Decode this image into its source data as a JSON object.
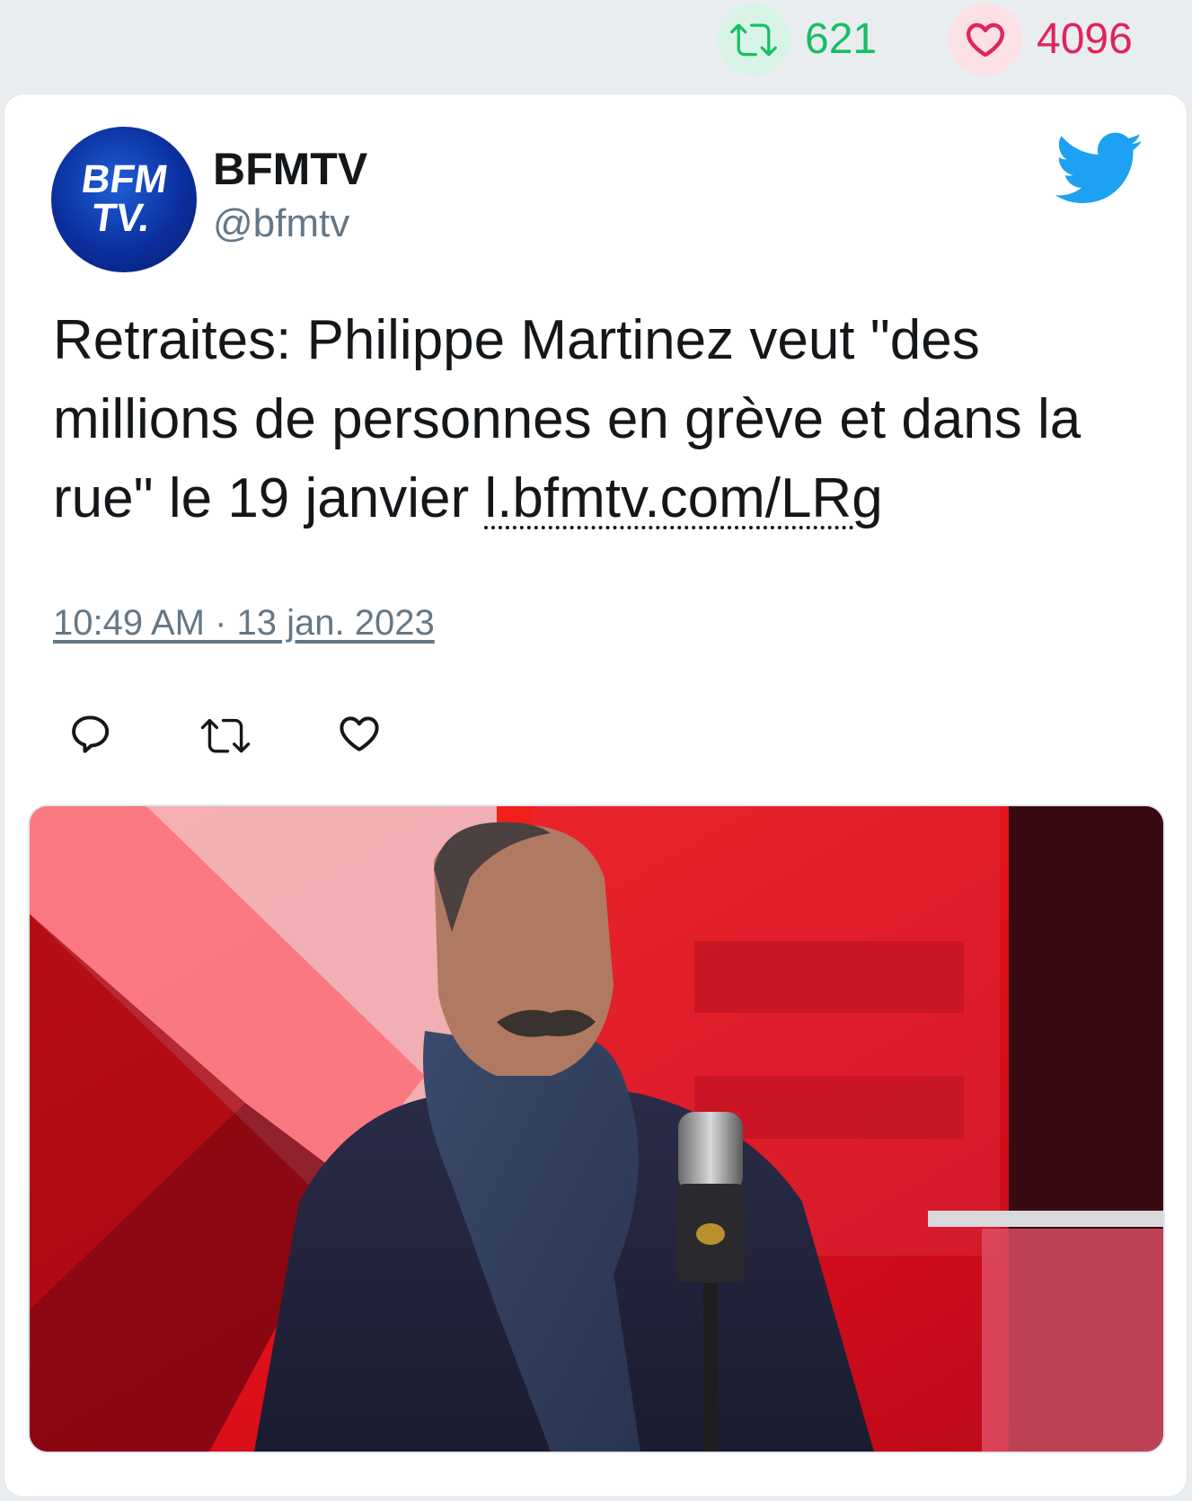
{
  "stats": {
    "retweet_icon": "retweet-icon",
    "retweet_count": "621",
    "like_icon": "heart-icon",
    "like_count": "4096"
  },
  "tweet": {
    "author_name": "BFMTV",
    "author_handle": "@bfmtv",
    "avatar_text_line1": "BFM",
    "avatar_text_line2": "TV.",
    "text": "Retraites: Philippe Martinez veut \"des millions de personnes en grève et dans la rue\" le 19 janvier ",
    "link": "l.bfmtv.com/LRg",
    "timestamp": "10:49 AM · 13 jan. 2023",
    "media_description": "Man in dark coat and scarf at a microphone in a red TV studio"
  },
  "actions": {
    "reply_icon": "reply-icon",
    "retweet_icon": "retweet-icon",
    "like_icon": "heart-icon"
  },
  "colors": {
    "background": "#eaedf0",
    "retweet_green": "#17bf63",
    "like_red": "#e0245e",
    "twitter_blue": "#1da1f2",
    "text_primary": "#14171a",
    "text_secondary": "#657786"
  }
}
